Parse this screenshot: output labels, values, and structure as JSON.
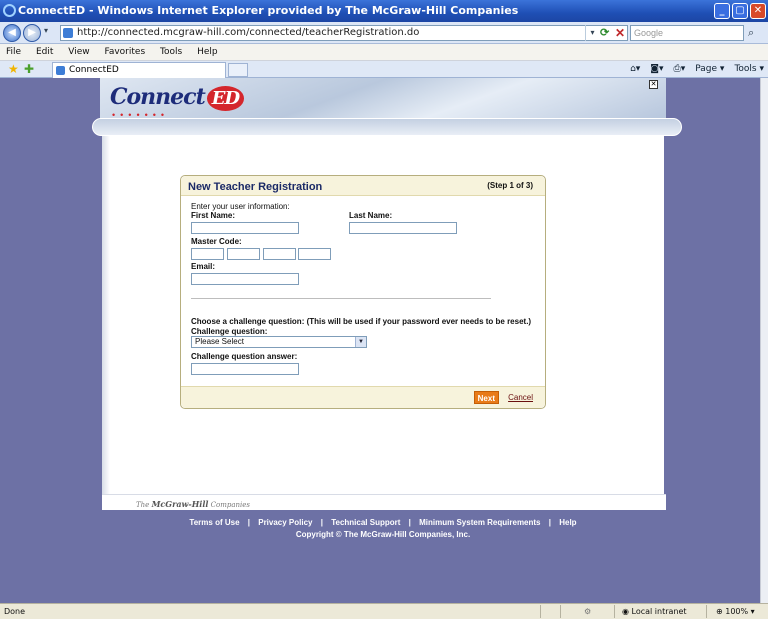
{
  "window": {
    "title": "ConnectED - Windows Internet Explorer provided by The McGraw-Hill Companies",
    "buttons": [
      "_",
      "▢",
      "✕"
    ]
  },
  "address_bar": {
    "url": "http://connected.mcgraw-hill.com/connected/teacherRegistration.do",
    "search_placeholder": "Google"
  },
  "menu": [
    "File",
    "Edit",
    "View",
    "Favorites",
    "Tools",
    "Help"
  ],
  "tab": {
    "label": "ConnectED"
  },
  "toolbar_right": {
    "page": "Page ▾",
    "tools": "Tools ▾"
  },
  "logo": {
    "text": "Connect",
    "badge": "ED"
  },
  "registration": {
    "title": "New Teacher Registration",
    "step": "(Step 1 of 3)",
    "intro": "Enter your user information:",
    "first_name_label": "First Name:",
    "last_name_label": "Last Name:",
    "master_code_label": "Master Code:",
    "email_label": "Email:",
    "challenge_intro": "Choose a challenge question: (This will be used if your password ever needs to be reset.)",
    "challenge_label": "Challenge question:",
    "challenge_selected": "Please Select",
    "answer_label": "Challenge question answer:",
    "next": "Next",
    "cancel": "Cancel"
  },
  "footer": {
    "brand_prefix": "The",
    "brand": "McGraw-Hill",
    "brand_suffix": "Companies",
    "links": [
      "Terms of Use",
      "Privacy Policy",
      "Technical Support",
      "Minimum System Requirements",
      "Help"
    ],
    "separator": "|",
    "copyright": "Copyright © The McGraw-Hill Companies, Inc."
  },
  "status": {
    "left": "Done",
    "zone": "Local intranet",
    "zoom": "100%"
  }
}
